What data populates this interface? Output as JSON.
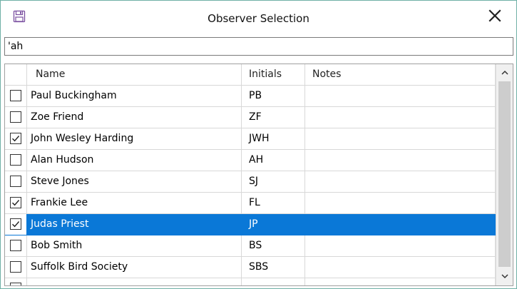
{
  "window": {
    "title": "Observer Selection",
    "icon": "save-icon",
    "close_icon": "close-icon"
  },
  "search": {
    "value": "'ah"
  },
  "table": {
    "columns": [
      "Name",
      "Initials",
      "Notes"
    ],
    "rows": [
      {
        "checked": false,
        "name": "Paul Buckingham",
        "initials": "PB",
        "notes": "",
        "selected": false
      },
      {
        "checked": false,
        "name": "Zoe Friend",
        "initials": "ZF",
        "notes": "",
        "selected": false
      },
      {
        "checked": true,
        "name": "John Wesley Harding",
        "initials": "JWH",
        "notes": "",
        "selected": false
      },
      {
        "checked": false,
        "name": "Alan Hudson",
        "initials": "AH",
        "notes": "",
        "selected": false
      },
      {
        "checked": false,
        "name": "Steve Jones",
        "initials": "SJ",
        "notes": "",
        "selected": false
      },
      {
        "checked": true,
        "name": "Frankie Lee",
        "initials": "FL",
        "notes": "",
        "selected": false
      },
      {
        "checked": true,
        "name": "Judas Priest",
        "initials": "JP",
        "notes": "",
        "selected": true
      },
      {
        "checked": false,
        "name": "Bob Smith",
        "initials": "BS",
        "notes": "",
        "selected": false
      },
      {
        "checked": false,
        "name": "Suffolk Bird Society",
        "initials": "SBS",
        "notes": "",
        "selected": false
      },
      {
        "checked": false,
        "name": "",
        "initials": "",
        "notes": "",
        "selected": false
      }
    ]
  },
  "colors": {
    "selection": "#0a78d7",
    "window_border": "#6fb0a6",
    "icon_purple": "#7a4fa0"
  }
}
